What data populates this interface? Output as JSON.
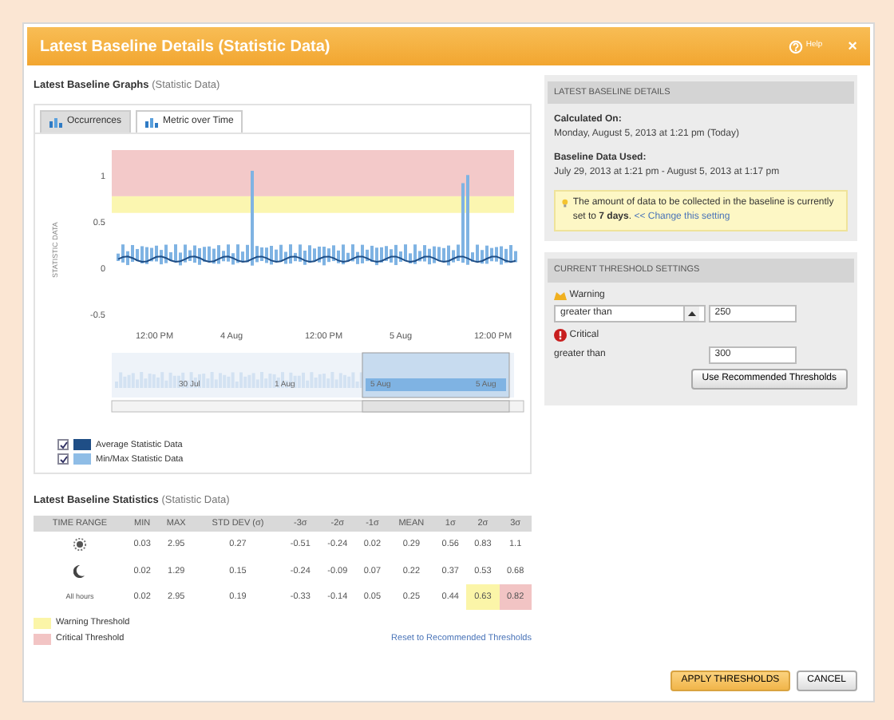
{
  "window": {
    "title": "Latest Baseline Details (Statistic Data)",
    "help": "Help",
    "close": "×"
  },
  "graphs": {
    "title": "Latest Baseline Graphs",
    "subtitle": "(Statistic Data)",
    "tabs": [
      {
        "label": "Occurrences",
        "selected": false
      },
      {
        "label": "Metric over Time",
        "selected": true
      }
    ],
    "y_axis_title": "STATISTIC DATA",
    "y_labels": [
      "1",
      "0.5",
      "0",
      "-0.5"
    ],
    "x_labels": [
      "12:00 PM",
      "4 Aug",
      "12:00 PM",
      "5 Aug",
      "12:00 PM"
    ],
    "navigator_labels": [
      "30 Jul",
      "1 Aug",
      "5 Aug",
      "5 Aug"
    ],
    "legend": [
      {
        "label": "Average Statistic Data",
        "checked": true,
        "color": "#1f4e86"
      },
      {
        "label": "Min/Max Statistic Data",
        "checked": true,
        "color": "#8fbde6"
      }
    ]
  },
  "statistics": {
    "title": "Latest Baseline Statistics",
    "subtitle": "(Statistic Data)",
    "columns": [
      "TIME RANGE",
      "MIN",
      "MAX",
      "STD DEV (σ)",
      "-3σ",
      "-2σ",
      "-1σ",
      "MEAN",
      "1σ",
      "2σ",
      "3σ"
    ],
    "rows": [
      {
        "cells": [
          {
            "kind": "day"
          },
          "0.03",
          "2.95",
          "0.27",
          "-0.51",
          "-0.24",
          "0.02",
          "0.29",
          "0.56",
          "0.83",
          "1.1"
        ]
      },
      {
        "cells": [
          {
            "kind": "night"
          },
          "0.02",
          "1.29",
          "0.15",
          "-0.24",
          "-0.09",
          "0.07",
          "0.22",
          "0.37",
          "0.53",
          "0.68"
        ]
      },
      {
        "cells": [
          {
            "kind": "text",
            "value": "All hours"
          },
          "0.02",
          "2.95",
          "0.19",
          "-0.33",
          "-0.14",
          "0.05",
          "0.25",
          "0.44",
          {
            "value": "0.63",
            "color": "#fbf5a8"
          },
          {
            "value": "0.82",
            "color": "#f2c4c4"
          }
        ]
      }
    ],
    "legend": [
      {
        "label": "Warning Threshold",
        "color": "#fbf5a8"
      },
      {
        "label": "Critical Threshold",
        "color": "#f2c4c4"
      }
    ],
    "reset_link": "Reset to Recommended Thresholds"
  },
  "details": {
    "header": "LATEST BASELINE DETAILS",
    "calculated_label": "Calculated On:",
    "calculated_value": "Monday, August 5, 2013 at 1:21 pm (Today)",
    "baseline_label": "Baseline Data Used:",
    "baseline_value": "July 29, 2013 at 1:21 pm - August 5, 2013 at 1:17 pm",
    "tip": "The amount of data to be collected in the baseline is currently set to **7 days**.",
    "tip_link": "<< Change this setting"
  },
  "thresholds": {
    "header": "CURRENT THRESHOLD SETTINGS",
    "items": [
      {
        "kind": "warning",
        "label": "Warning",
        "operator": "greater than",
        "editable": true,
        "value": "250"
      },
      {
        "kind": "critical",
        "label": "Critical",
        "operator": "greater than",
        "editable": false,
        "value": "300"
      }
    ],
    "recommend_button": "Use Recommended Thresholds"
  },
  "buttons": [
    {
      "label": "APPLY THRESHOLDS",
      "primary": true
    },
    {
      "label": "CANCEL",
      "primary": false
    }
  ]
}
